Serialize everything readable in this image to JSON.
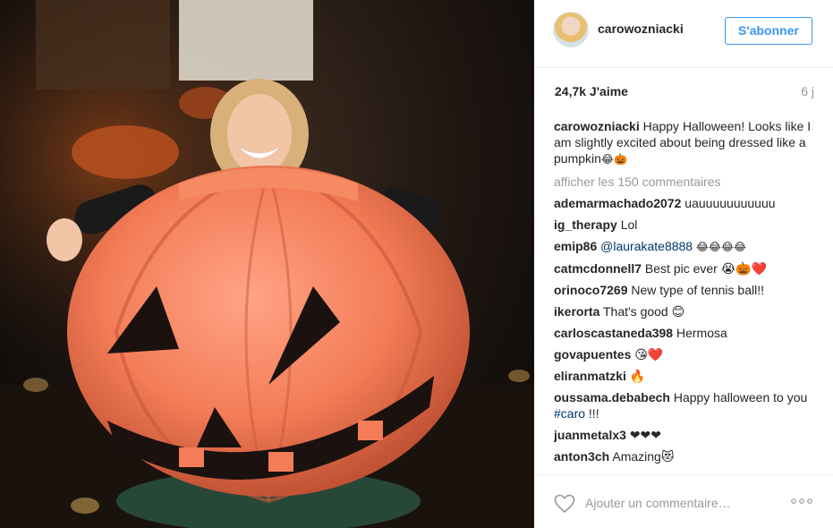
{
  "post": {
    "username": "carowozniacki",
    "follow_label": "S'abonner",
    "likes": "24,7k J'aime",
    "age": "6 j",
    "caption_user": "carowozniacki",
    "caption_text": " Happy Halloween! Looks like I am slightly excited about being dressed like a pumpkin",
    "caption_emoji": "😂🎃",
    "view_all": "afficher les 150 commentaires",
    "add_comment_placeholder": "Ajouter un commentaire…"
  },
  "comments": [
    {
      "user": "ademarmachado2072",
      "text": " uauuuuuuuuuuu"
    },
    {
      "user": "ig_therapy",
      "text": " Lol"
    },
    {
      "user": "emip86",
      "mention": " @laurakate8888",
      "text": " 😂😂😂😂"
    },
    {
      "user": "catmcdonnell7",
      "text": " Best pic ever 😭🎃❤️"
    },
    {
      "user": "orinoco7269",
      "text": " New type of tennis ball!!"
    },
    {
      "user": "ikerorta",
      "text": " That's good 😊"
    },
    {
      "user": "carloscastaneda398",
      "text": " Hermosa"
    },
    {
      "user": "govapuentes",
      "text": " 😘❤️"
    },
    {
      "user": "eliranmatzki",
      "text": " 🔥"
    },
    {
      "user": "oussama.debabech",
      "text": " Happy halloween to you ",
      "hashtag": "#caro",
      "tail": " !!!"
    },
    {
      "user": "juanmetalx3",
      "text": " ❤❤❤"
    },
    {
      "user": "anton3ch",
      "text": " Amazing😻"
    }
  ],
  "icons": {
    "like": "heart-outline-icon",
    "options": "more-options-icon"
  },
  "colors": {
    "accent": "#3897f0",
    "link": "#003569",
    "muted": "#999999",
    "pumpkin": "#f07a55"
  }
}
